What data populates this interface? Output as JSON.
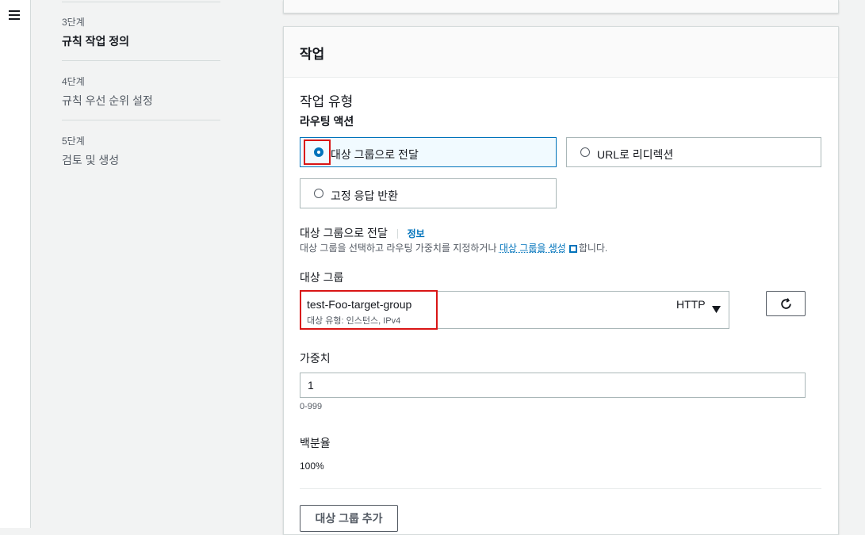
{
  "nav": {
    "menu_icon": "hamburger-icon"
  },
  "steps": [
    {
      "label": "3단계",
      "title": "규칙 작업 정의",
      "active": true
    },
    {
      "label": "4단계",
      "title": "규칙 우선 순위 설정",
      "active": false
    },
    {
      "label": "5단계",
      "title": "검토 및 생성",
      "active": false
    }
  ],
  "panel": {
    "header": "작업",
    "action_type_title": "작업 유형",
    "routing_action_label": "라우팅 액션",
    "options": [
      {
        "label": "대상 그룹으로 전달",
        "selected": true
      },
      {
        "label": "URL로 리디렉션",
        "selected": false
      },
      {
        "label": "고정 응답 반환",
        "selected": false
      }
    ],
    "forward": {
      "title": "대상 그룹으로 전달",
      "info_link": "정보",
      "desc_before": "대상 그룹을 선택하고 라우팅 가중치를 지정하거나 ",
      "desc_link": "대상 그룹을 생성",
      "desc_after": "합니다."
    },
    "target_group": {
      "label": "대상 그룹",
      "name": "test-Foo-target-group",
      "detail": "대상 유형: 인스턴스, IPv4",
      "protocol": "HTTP",
      "dropdown_icon": "caret-down-icon",
      "refresh_icon": "refresh-icon"
    },
    "weight": {
      "label": "가중치",
      "value": "1",
      "hint": "0-999"
    },
    "percent": {
      "label": "백분율",
      "value": "100%"
    },
    "add_button": "대상 그룹 추가"
  },
  "colors": {
    "accent": "#0073bb",
    "highlight": "#d91515"
  }
}
